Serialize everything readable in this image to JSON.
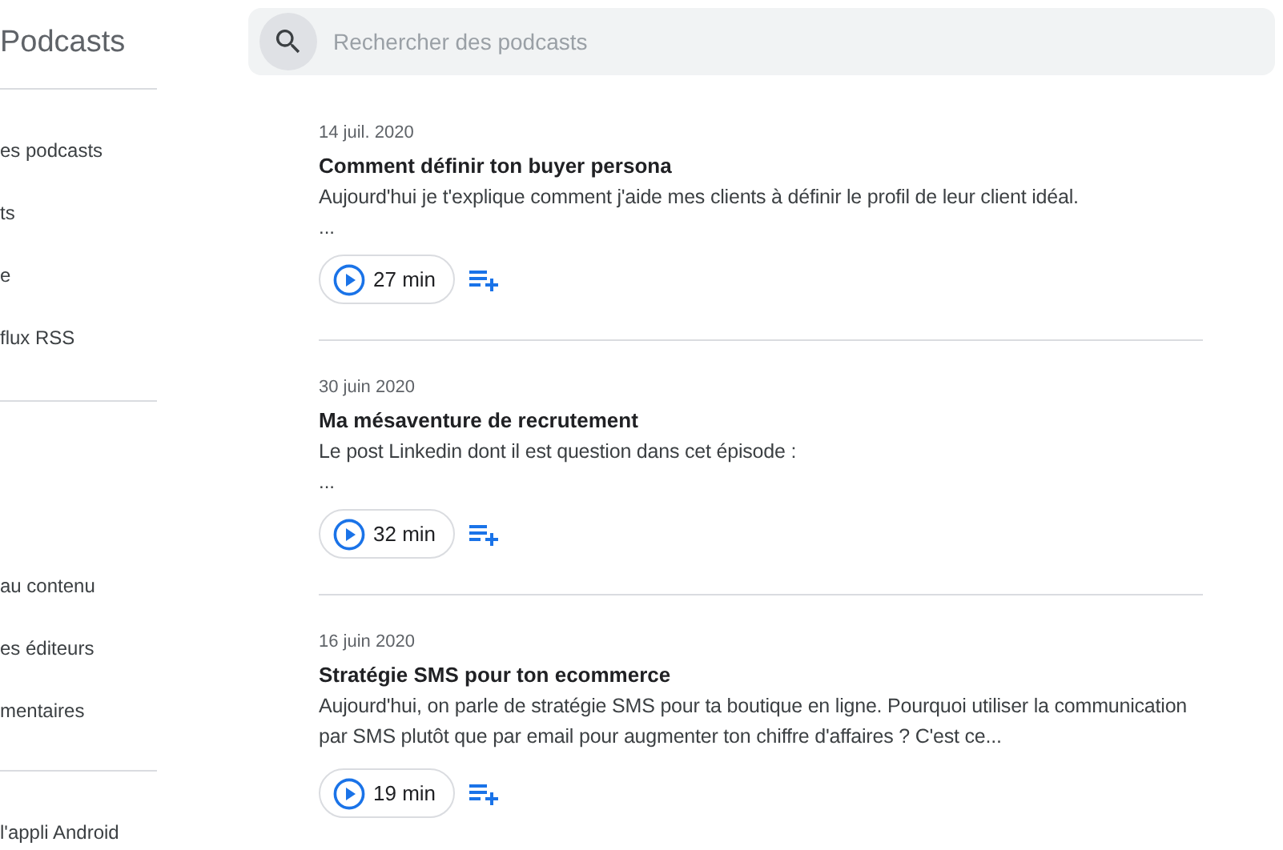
{
  "sidebar": {
    "title": "Podcasts",
    "sections": [
      [
        "es podcasts",
        "ts",
        "e",
        "flux RSS"
      ],
      [
        "au contenu",
        "es éditeurs",
        "mentaires"
      ],
      [
        "l'appli Android"
      ]
    ]
  },
  "search": {
    "placeholder": "Rechercher des podcasts"
  },
  "episodes": [
    {
      "date": "14 juil. 2020",
      "title": "Comment définir ton buyer persona",
      "description": "Aujourd'hui je t'explique comment j'aide mes clients à définir le profil de leur client idéal.",
      "more": "...",
      "duration": "27 min"
    },
    {
      "date": "30 juin 2020",
      "title": "Ma mésaventure de recrutement",
      "description": "Le post Linkedin dont il est question dans cet épisode :",
      "more": "...",
      "duration": "32 min"
    },
    {
      "date": "16 juin 2020",
      "title": "Stratégie SMS pour ton ecommerce",
      "description": "Aujourd'hui, on parle de stratégie SMS pour ta boutique en ligne. Pourquoi utiliser la communication par SMS plutôt que par email pour augmenter ton chiffre d'affaires ? C'est ce...",
      "duration": "19 min"
    }
  ]
}
